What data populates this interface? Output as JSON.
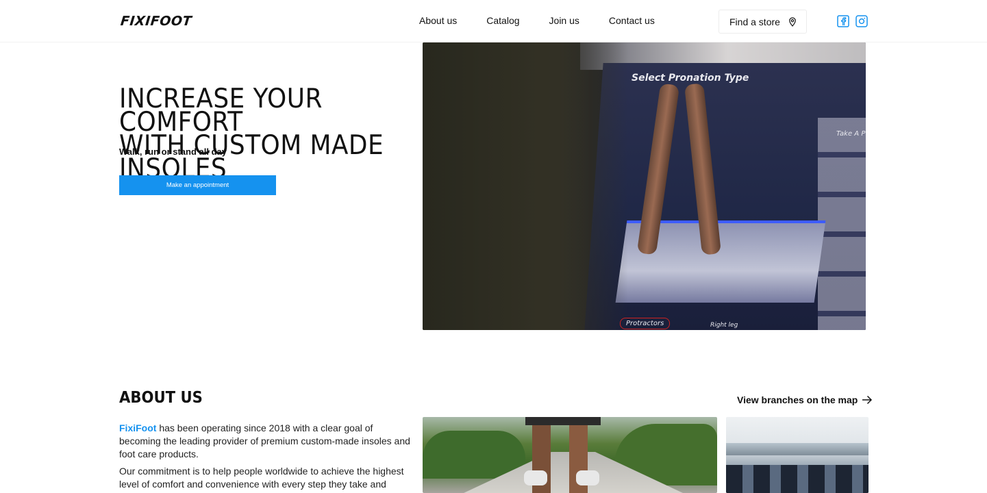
{
  "header": {
    "logo": "FIXIFOOT",
    "nav": [
      "About us",
      "Catalog",
      "Join us",
      "Contact us"
    ],
    "store_button": "Find a store",
    "social": {
      "facebook": "facebook-icon",
      "instagram": "instagram-icon"
    }
  },
  "hero": {
    "title_line1": "INCREASE YOUR COMFORT",
    "title_line2": "WITH CUSTOM MADE INSOLES",
    "subtitle": "Walk, run or stand all day",
    "cta": "Make an appointment",
    "media_text": {
      "screen_title": "Select Pronation Type",
      "protractors": "Protractors",
      "right_leg": "Right leg",
      "take_photo": "Take A P"
    }
  },
  "about": {
    "title": "ABOUT US",
    "branches_link": "View branches on the map",
    "brand": "FixiFoot",
    "p1_rest": " has been operating since 2018 with a clear goal of becoming the leading provider of premium custom-made insoles and foot care products.",
    "p2": "Our commitment is to help people worldwide to achieve the highest level of comfort and convenience with every step they take and ensure they"
  },
  "colors": {
    "accent": "#1592ef",
    "text": "#111111"
  }
}
